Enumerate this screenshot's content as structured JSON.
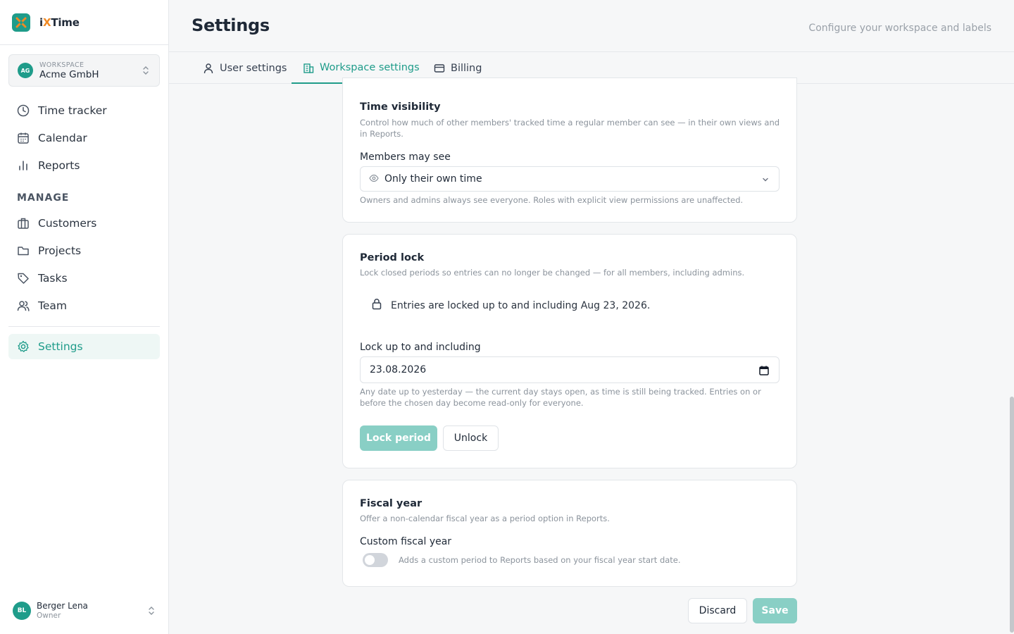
{
  "app": {
    "name_prefix": "i",
    "name_accent": "X",
    "name_suffix": "Time",
    "logo_icon": "x-logo-icon"
  },
  "workspace": {
    "label": "WORKSPACE",
    "name": "Acme GmbH",
    "initials": "AG"
  },
  "sidebar": {
    "main_items": [
      {
        "label": "Time tracker",
        "icon": "clock-icon"
      },
      {
        "label": "Calendar",
        "icon": "calendar-icon"
      },
      {
        "label": "Reports",
        "icon": "bar-chart-icon"
      }
    ],
    "section_label": "MANAGE",
    "manage_items": [
      {
        "label": "Customers",
        "icon": "briefcase-icon"
      },
      {
        "label": "Projects",
        "icon": "folder-icon"
      },
      {
        "label": "Tasks",
        "icon": "tag-icon"
      },
      {
        "label": "Team",
        "icon": "users-icon"
      }
    ],
    "settings_item": {
      "label": "Settings",
      "icon": "gear-icon",
      "active": true
    }
  },
  "user": {
    "name": "Berger Lena",
    "role": "Owner",
    "initials": "BL"
  },
  "header": {
    "title": "Settings",
    "subtitle": "Configure your workspace and labels"
  },
  "tabs": [
    {
      "label": "User settings",
      "icon": "user-icon",
      "active": false
    },
    {
      "label": "Workspace settings",
      "icon": "building-icon",
      "active": true
    },
    {
      "label": "Billing",
      "icon": "credit-card-icon",
      "active": false
    }
  ],
  "time_visibility": {
    "title": "Time visibility",
    "description": "Control how much of other members' tracked time a regular member can see — in their own views and in Reports.",
    "field_label": "Members may see",
    "selected": "Only their own time",
    "hint": "Owners and admins always see everyone. Roles with explicit view permissions are unaffected."
  },
  "period_lock": {
    "title": "Period lock",
    "description": "Lock closed periods so entries can no longer be changed — for all members, including admins.",
    "status": "Entries are locked up to and including Aug 23, 2026.",
    "field_label": "Lock up to and including",
    "date_value": "23.08.2026",
    "hint": "Any date up to yesterday — the current day stays open, as time is still being tracked. Entries on or before the chosen day become read-only for everyone.",
    "lock_button": "Lock period",
    "unlock_button": "Unlock"
  },
  "fiscal_year": {
    "title": "Fiscal year",
    "description": "Offer a non-calendar fiscal year as a period option in Reports.",
    "field_label": "Custom fiscal year",
    "toggle_enabled": false,
    "toggle_text": "Adds a custom period to Reports based on your fiscal year start date."
  },
  "footer": {
    "discard_button": "Discard",
    "save_button": "Save"
  },
  "colors": {
    "accent": "#1f9c8a",
    "accent_light": "#89cfc5",
    "logo_orange": "#f08a24"
  }
}
